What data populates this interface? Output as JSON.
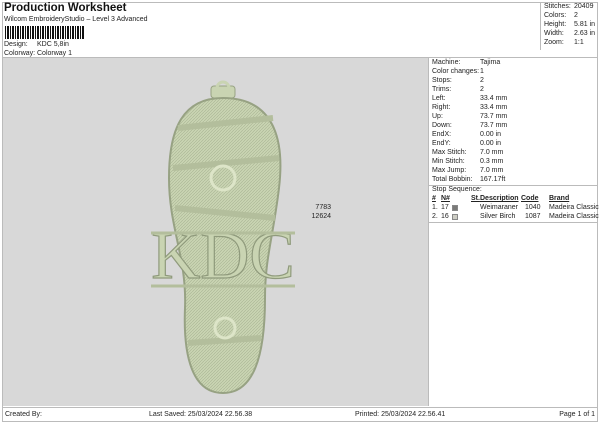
{
  "header": {
    "title": "Production Worksheet",
    "subtitle": "Wilcom EmbroideryStudio – Level 3 Advanced",
    "design_label": "Design:",
    "design": "KDC 5,8in",
    "colorway_label": "Colorway:",
    "colorway": "Colorway 1"
  },
  "stats": [
    {
      "k": "Stitches:",
      "v": "20409"
    },
    {
      "k": "Colors:",
      "v": "2"
    },
    {
      "k": "Height:",
      "v": "5.81 in"
    },
    {
      "k": "Width:",
      "v": "2.63 in"
    },
    {
      "k": "Zoom:",
      "v": "1:1"
    }
  ],
  "design_text": "KDC",
  "info": [
    {
      "k": "Machine:",
      "v": "Tajima"
    },
    {
      "k": "Color changes:",
      "v": "1"
    },
    {
      "k": "Stops:",
      "v": "2"
    },
    {
      "k": "Trims:",
      "v": "2"
    },
    {
      "k": "Left:",
      "v": "33.4 mm"
    },
    {
      "k": "Right:",
      "v": "33.4 mm"
    },
    {
      "k": "Up:",
      "v": "73.7 mm"
    },
    {
      "k": "Down:",
      "v": "73.7 mm"
    },
    {
      "k": "EndX:",
      "v": "0.00 in"
    },
    {
      "k": "EndY:",
      "v": "0.00 in"
    },
    {
      "k": "Max Stitch:",
      "v": "7.0 mm"
    },
    {
      "k": "Min Stitch:",
      "v": "0.3 mm"
    },
    {
      "k": "Max Jump:",
      "v": "7.0 mm"
    },
    {
      "k": "Total Bobbin:",
      "v": "167.17ft"
    }
  ],
  "stop_sequence": {
    "label": "Stop Sequence:",
    "headers": [
      "#",
      "N#",
      "St.",
      "Description",
      "Code",
      "Brand"
    ],
    "rows": [
      {
        "n": "1.",
        "nn": "17",
        "color": "#7a7a78",
        "st": "7783",
        "desc": "Weimaraner",
        "code": "1040",
        "brand": "Madeira Classic 40"
      },
      {
        "n": "2.",
        "nn": "16",
        "color": "#cdcdc4",
        "st": "12624",
        "desc": "Silver Birch",
        "code": "1087",
        "brand": "Madeira Classic 40"
      }
    ]
  },
  "footer": {
    "created": "Created By:",
    "saved": "Last Saved: 25/03/2024 22.56.38",
    "printed": "Printed: 25/03/2024 22.56.41",
    "page": "Page 1 of 1"
  }
}
